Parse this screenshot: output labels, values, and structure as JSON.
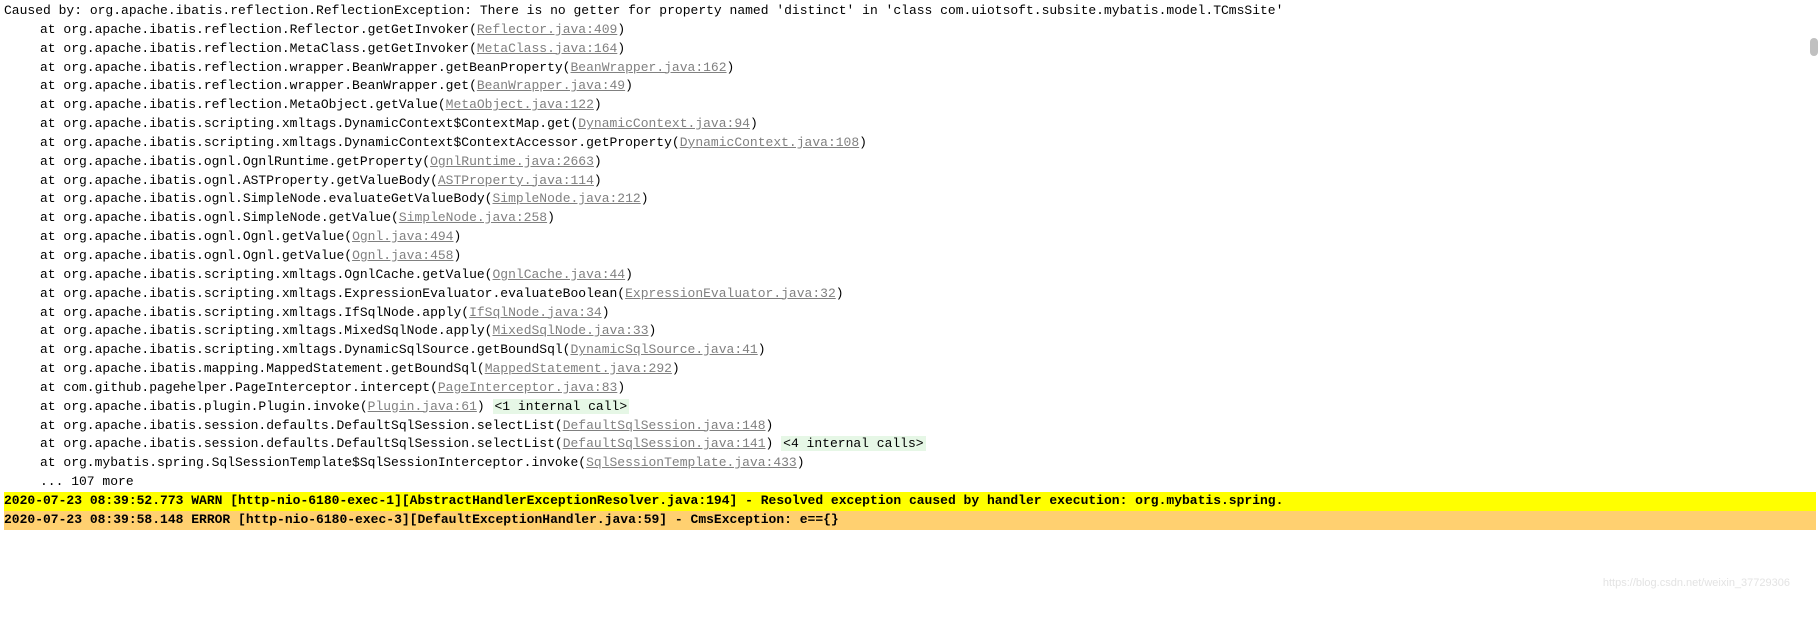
{
  "header": {
    "causedBy": "Caused by: org.apache.ibatis.reflection.ReflectionException: There is no getter for property named 'distinct' in 'class com.uiotsoft.subsite.mybatis.model.TCmsSite'"
  },
  "stackFrames": [
    {
      "prefix": "at org.apache.ibatis.reflection.Reflector.getGetInvoker(",
      "link": "Reflector.java:409",
      "suffix": ")"
    },
    {
      "prefix": "at org.apache.ibatis.reflection.MetaClass.getGetInvoker(",
      "link": "MetaClass.java:164",
      "suffix": ")"
    },
    {
      "prefix": "at org.apache.ibatis.reflection.wrapper.BeanWrapper.getBeanProperty(",
      "link": "BeanWrapper.java:162",
      "suffix": ")"
    },
    {
      "prefix": "at org.apache.ibatis.reflection.wrapper.BeanWrapper.get(",
      "link": "BeanWrapper.java:49",
      "suffix": ")"
    },
    {
      "prefix": "at org.apache.ibatis.reflection.MetaObject.getValue(",
      "link": "MetaObject.java:122",
      "suffix": ")"
    },
    {
      "prefix": "at org.apache.ibatis.scripting.xmltags.DynamicContext$ContextMap.get(",
      "link": "DynamicContext.java:94",
      "suffix": ")"
    },
    {
      "prefix": "at org.apache.ibatis.scripting.xmltags.DynamicContext$ContextAccessor.getProperty(",
      "link": "DynamicContext.java:108",
      "suffix": ")"
    },
    {
      "prefix": "at org.apache.ibatis.ognl.OgnlRuntime.getProperty(",
      "link": "OgnlRuntime.java:2663",
      "suffix": ")"
    },
    {
      "prefix": "at org.apache.ibatis.ognl.ASTProperty.getValueBody(",
      "link": "ASTProperty.java:114",
      "suffix": ")"
    },
    {
      "prefix": "at org.apache.ibatis.ognl.SimpleNode.evaluateGetValueBody(",
      "link": "SimpleNode.java:212",
      "suffix": ")"
    },
    {
      "prefix": "at org.apache.ibatis.ognl.SimpleNode.getValue(",
      "link": "SimpleNode.java:258",
      "suffix": ")"
    },
    {
      "prefix": "at org.apache.ibatis.ognl.Ognl.getValue(",
      "link": "Ognl.java:494",
      "suffix": ")"
    },
    {
      "prefix": "at org.apache.ibatis.ognl.Ognl.getValue(",
      "link": "Ognl.java:458",
      "suffix": ")"
    },
    {
      "prefix": "at org.apache.ibatis.scripting.xmltags.OgnlCache.getValue(",
      "link": "OgnlCache.java:44",
      "suffix": ")"
    },
    {
      "prefix": "at org.apache.ibatis.scripting.xmltags.ExpressionEvaluator.evaluateBoolean(",
      "link": "ExpressionEvaluator.java:32",
      "suffix": ")"
    },
    {
      "prefix": "at org.apache.ibatis.scripting.xmltags.IfSqlNode.apply(",
      "link": "IfSqlNode.java:34",
      "suffix": ")"
    },
    {
      "prefix": "at org.apache.ibatis.scripting.xmltags.MixedSqlNode.apply(",
      "link": "MixedSqlNode.java:33",
      "suffix": ")"
    },
    {
      "prefix": "at org.apache.ibatis.scripting.xmltags.DynamicSqlSource.getBoundSql(",
      "link": "DynamicSqlSource.java:41",
      "suffix": ")"
    },
    {
      "prefix": "at org.apache.ibatis.mapping.MappedStatement.getBoundSql(",
      "link": "MappedStatement.java:292",
      "suffix": ")"
    },
    {
      "prefix": "at com.github.pagehelper.PageInterceptor.intercept(",
      "link": "PageInterceptor.java:83",
      "suffix": ")"
    },
    {
      "prefix": "at org.apache.ibatis.plugin.Plugin.invoke(",
      "link": "Plugin.java:61",
      "suffix": ")",
      "tag": "<1 internal call>"
    },
    {
      "prefix": "at org.apache.ibatis.session.defaults.DefaultSqlSession.selectList(",
      "link": "DefaultSqlSession.java:148",
      "suffix": ")"
    },
    {
      "prefix": "at org.apache.ibatis.session.defaults.DefaultSqlSession.selectList(",
      "link": "DefaultSqlSession.java:141",
      "suffix": ")",
      "tag": "<4 internal calls>"
    },
    {
      "prefix": "at org.mybatis.spring.SqlSessionTemplate$SqlSessionInterceptor.invoke(",
      "link": "SqlSessionTemplate.java:433",
      "suffix": ")"
    }
  ],
  "more": "... 107 more",
  "warnLine": "2020-07-23 08:39:52.773 WARN [http-nio-6180-exec-1][AbstractHandlerExceptionResolver.java:194] - Resolved exception caused by handler execution: org.mybatis.spring.",
  "errorLine": "2020-07-23 08:39:58.148 ERROR [http-nio-6180-exec-3][DefaultExceptionHandler.java:59] - CmsException: e=={}",
  "watermark": "https://blog.csdn.net/weixin_37729306"
}
